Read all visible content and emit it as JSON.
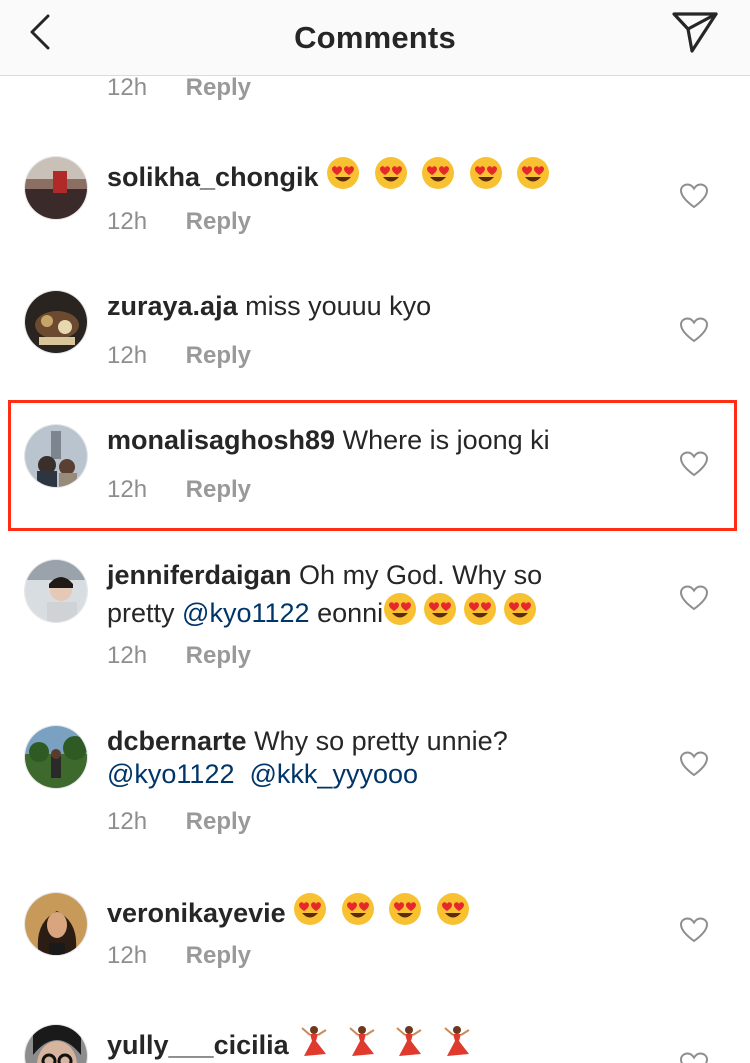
{
  "header": {
    "title": "Comments"
  },
  "top_partial": {
    "time": "12h",
    "reply_label": "Reply"
  },
  "comments": [
    {
      "username": "solikha_chongik",
      "text": "",
      "emoji": "heart-eyes",
      "emoji_count": 5,
      "time": "12h",
      "reply_label": "Reply"
    },
    {
      "username": "zuraya.aja",
      "text": "miss youuu kyo",
      "time": "12h",
      "reply_label": "Reply"
    },
    {
      "username": "monalisaghosh89",
      "text": "Where is joong ki",
      "time": "12h",
      "reply_label": "Reply",
      "highlighted": true
    },
    {
      "username": "jenniferdaigan",
      "text_line1": "Oh my God. Why so",
      "text_line2_pre": "pretty",
      "mention": "@kyo1122",
      "text_line2_post": "eonni",
      "emoji": "heart-eyes",
      "emoji_count": 4,
      "time": "12h",
      "reply_label": "Reply"
    },
    {
      "username": "dcbernarte",
      "text": "Why so pretty unnie?",
      "mentions": [
        "@kyo1122",
        "@kkk_yyyooo"
      ],
      "time": "12h",
      "reply_label": "Reply"
    },
    {
      "username": "veronikayevie",
      "text": "",
      "emoji": "heart-eyes",
      "emoji_count": 4,
      "time": "12h",
      "reply_label": "Reply"
    },
    {
      "username": "yully___cicilia",
      "text": "",
      "emoji": "dancer",
      "emoji_count": 4
    }
  ],
  "colors": {
    "highlight_border": "#ff2d14",
    "mention": "#003569",
    "meta_gray": "#8e8e8e"
  }
}
